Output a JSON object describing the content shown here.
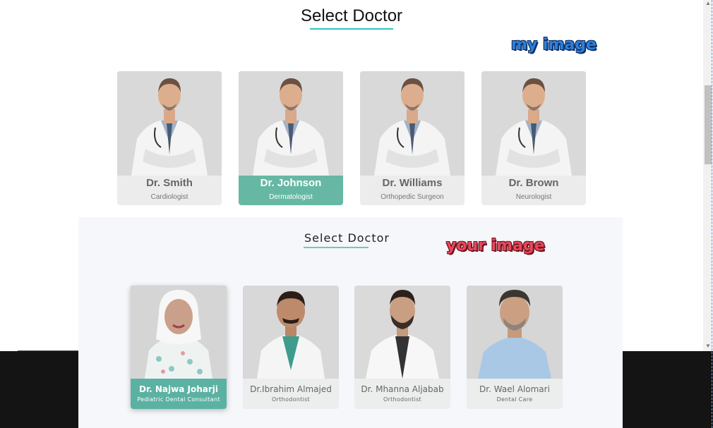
{
  "top_section": {
    "title": "Select Doctor",
    "accent_color": "#2ec4c4",
    "annotation": "my image",
    "doctors": [
      {
        "name": "Dr. Smith",
        "specialty": "Cardiologist",
        "selected": false
      },
      {
        "name": "Dr. Johnson",
        "specialty": "Dermatologist",
        "selected": true
      },
      {
        "name": "Dr. Williams",
        "specialty": "Orthopedic Surgeon",
        "selected": false
      },
      {
        "name": "Dr. Brown",
        "specialty": "Neurologist",
        "selected": false
      }
    ],
    "selected_color": "#66b8a4"
  },
  "bottom_section": {
    "title": "Select Doctor",
    "annotation": "your image",
    "doctors": [
      {
        "name": "Dr. Najwa Joharji",
        "specialty": "Pediatric Dental Consultant",
        "selected": true
      },
      {
        "name": "Dr.Ibrahim Almajed",
        "specialty": "Orthodontist",
        "selected": false
      },
      {
        "name": "Dr. Mhanna Aljabab",
        "specialty": "Orthodontist",
        "selected": false
      },
      {
        "name": "Dr. Wael Alomari",
        "specialty": "Dental Care",
        "selected": false
      }
    ],
    "selected_color": "#5bb2a2"
  }
}
